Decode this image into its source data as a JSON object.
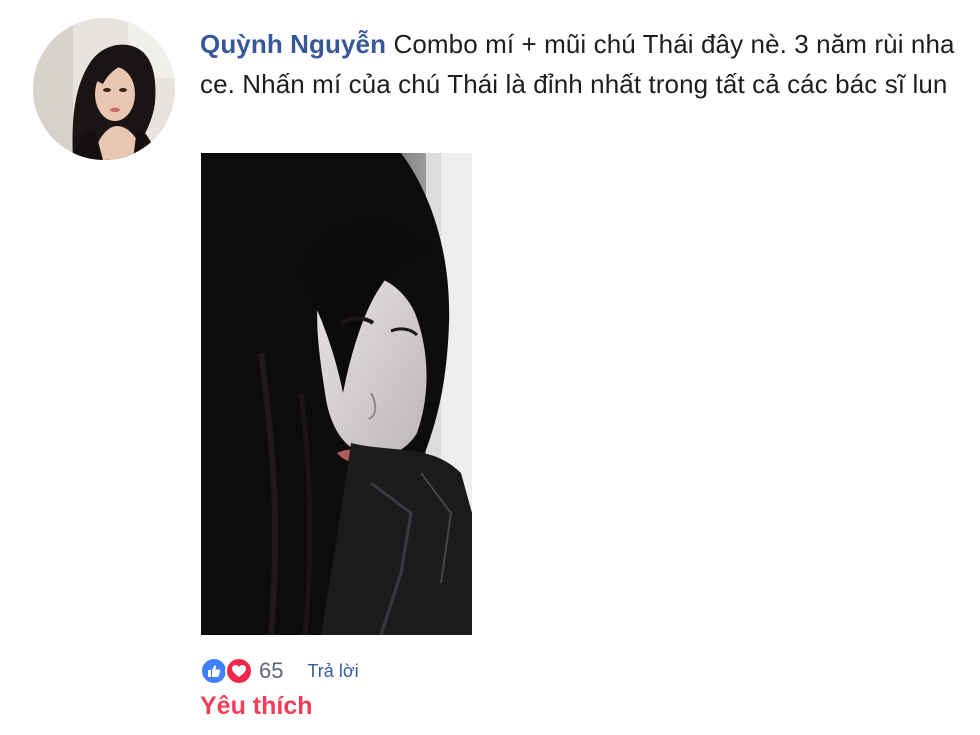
{
  "comment": {
    "author": "Quỳnh Nguyễn",
    "text": "Combo mí + mũi chú Thái đây nè. 3 năm rùi nha ce. Nhấn mí của chú Thái là đỉnh nhất trong tất cả các bác sĩ lun",
    "avatar_icon": "profile-photo",
    "photo_icon": "attached-photo"
  },
  "actions": {
    "reaction_count": "65",
    "reply_label": "Trả lời",
    "reaction_label": "Yêu thích",
    "reaction_icons": [
      "like-icon",
      "love-icon"
    ]
  },
  "colors": {
    "author": "#365899",
    "text": "#1c1e21",
    "like": "#4080ff",
    "love": "#f0284a",
    "reaction_label": "#f33e58"
  }
}
